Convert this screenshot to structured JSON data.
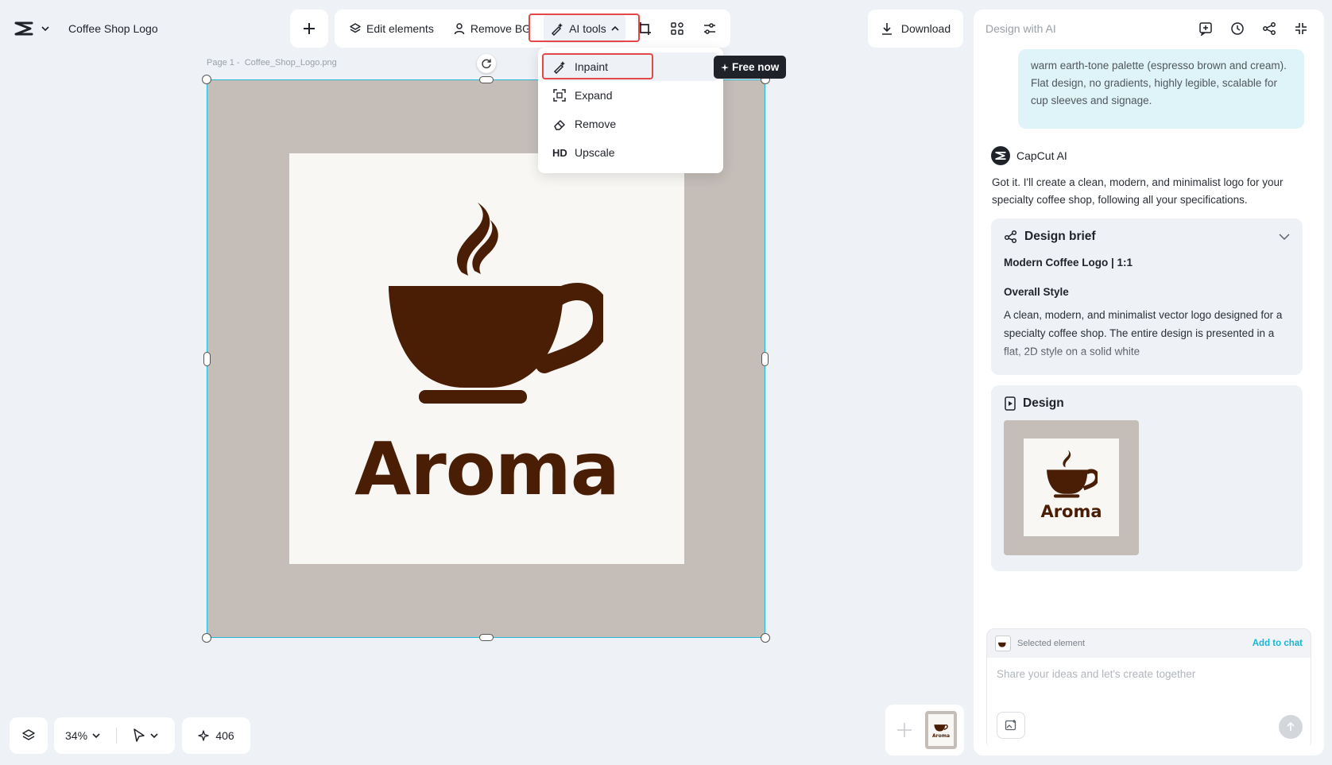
{
  "app": {
    "project_title": "Coffee Shop Logo"
  },
  "toolbar": {
    "edit_elements": "Edit elements",
    "remove_bg": "Remove BG",
    "ai_tools": "AI tools",
    "download": "Download"
  },
  "ai_menu": {
    "items": [
      {
        "label": "Inpaint",
        "icon": "brush-sparkle-icon"
      },
      {
        "label": "Expand",
        "icon": "expand-icon"
      },
      {
        "label": "Remove",
        "icon": "eraser-icon"
      },
      {
        "label": "Upscale",
        "icon": "HD"
      }
    ],
    "badge": "Free now"
  },
  "canvas": {
    "page_label": "Page 1 -",
    "file_name": "Coffee_Shop_Logo.png",
    "logo_text": "Aroma",
    "colors": {
      "background": "#c4bdb8",
      "logo_brown": "#4a1e05",
      "inner": "#f8f7f4",
      "selection": "#26b8d8"
    }
  },
  "bottom": {
    "zoom": "34%",
    "credits": "406"
  },
  "panel": {
    "title": "Design with AI",
    "user_message": "warm earth-tone palette (espresso brown and cream). Flat design, no gradients, highly legible, scalable for cup sleeves and signage.",
    "ai_name": "CapCut AI",
    "ai_reply": "Got it. I'll create a clean, modern, and minimalist logo for your specialty coffee shop, following all your specifications.",
    "brief": {
      "title": "Design brief",
      "subtitle": "Modern Coffee Logo | 1:1",
      "style_heading": "Overall Style",
      "style_text": "A clean, modern, and minimalist vector logo designed for a specialty coffee shop. The entire design is presented in a flat, 2D style on a solid white"
    },
    "design": {
      "title": "Design",
      "thumb_text": "Aroma"
    },
    "chat": {
      "selected_label": "Selected element",
      "add_to_chat": "Add to chat",
      "placeholder": "Share your ideas and let's create together"
    },
    "accent": "#19b6d3"
  }
}
